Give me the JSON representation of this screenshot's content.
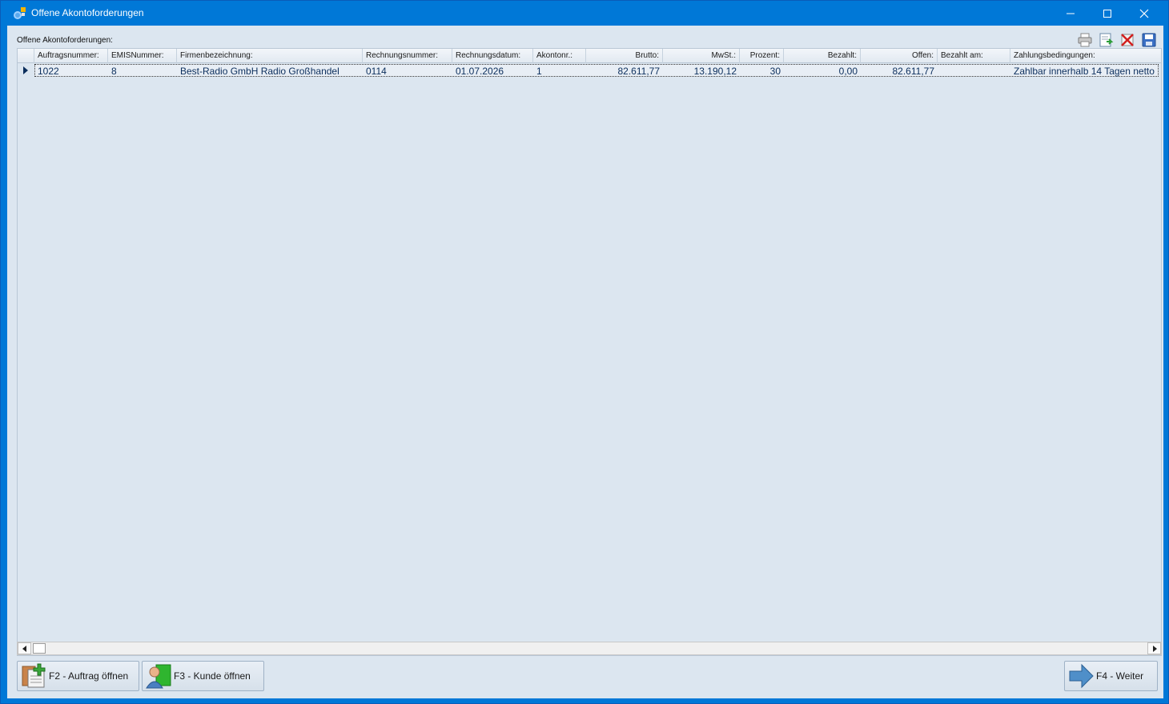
{
  "window": {
    "title": "Offene Akontoforderungen"
  },
  "panel": {
    "label": "Offene Akontoforderungen:"
  },
  "toolbar": {
    "icons": [
      "printer-icon",
      "export-icon",
      "delete-icon",
      "save-icon"
    ]
  },
  "table": {
    "columns": [
      "Auftragsnummer:",
      "EMISNummer:",
      "Firmenbezeichnung:",
      "Rechnungsnummer:",
      "Rechnungsdatum:",
      "Akontonr.:",
      "Brutto:",
      "MwSt.:",
      "Prozent:",
      "Bezahlt:",
      "Offen:",
      "Bezahlt am:",
      "Zahlungsbedingungen:"
    ],
    "rows": [
      {
        "auftragsnummer": "1022",
        "emisnummer": "8",
        "firmenbezeichnung": "Best-Radio GmbH Radio Großhandel",
        "rechnungsnummer": "0114",
        "rechnungsdatum": "01.07.2026",
        "akontonr": "1",
        "brutto": "82.611,77",
        "mwst": "13.190,12",
        "prozent": "30",
        "bezahlt": "0,00",
        "offen": "82.611,77",
        "bezahlt_am": "",
        "zahlungsbedingungen": "Zahlbar innerhalb 14 Tagen netto"
      }
    ]
  },
  "footer": {
    "f2_label": "F2 - Auftrag öffnen",
    "f3_label": "F3 - Kunde öffnen",
    "f4_label": "F4 - Weiter"
  },
  "colors": {
    "titlebar": "#0078d7",
    "client_bg": "#dce6f0",
    "cell_text": "#0b2e5c"
  }
}
